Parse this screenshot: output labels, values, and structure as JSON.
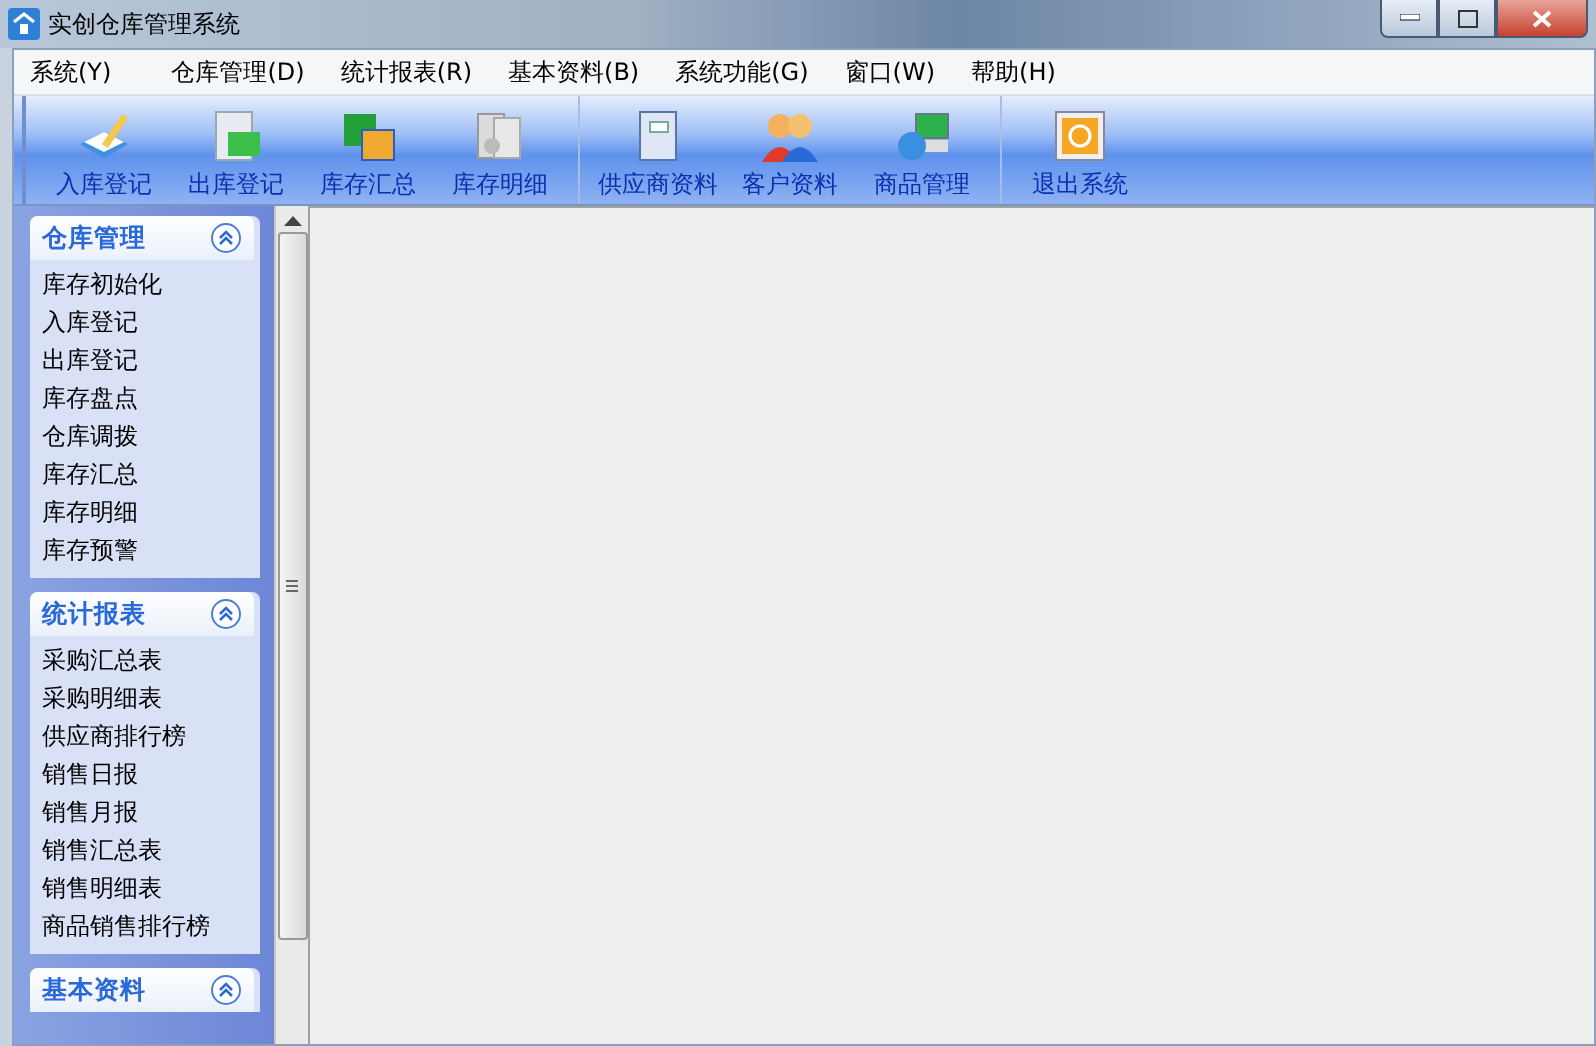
{
  "window": {
    "title": "实创仓库管理系统"
  },
  "menu": [
    "系统(Y)",
    "仓库管理(D)",
    "统计报表(R)",
    "基本资料(B)",
    "系统功能(G)",
    "窗口(W)",
    "帮助(H)"
  ],
  "toolbar": {
    "groups": [
      [
        "入库登记",
        "出库登记",
        "库存汇总",
        "库存明细"
      ],
      [
        "供应商资料",
        "客户资料",
        "商品管理"
      ],
      [
        "退出系统"
      ]
    ]
  },
  "sidebar": {
    "sections": [
      {
        "title": "仓库管理",
        "expanded": true,
        "items": [
          "库存初始化",
          "入库登记",
          "出库登记",
          "库存盘点",
          "仓库调拨",
          "库存汇总",
          "库存明细",
          "库存预警"
        ]
      },
      {
        "title": "统计报表",
        "expanded": true,
        "items": [
          "采购汇总表",
          "采购明细表",
          "供应商排行榜",
          "销售日报",
          "销售月报",
          "销售汇总表",
          "销售明细表",
          "商品销售排行榜"
        ]
      },
      {
        "title": "基本资料",
        "expanded": true
      }
    ]
  }
}
